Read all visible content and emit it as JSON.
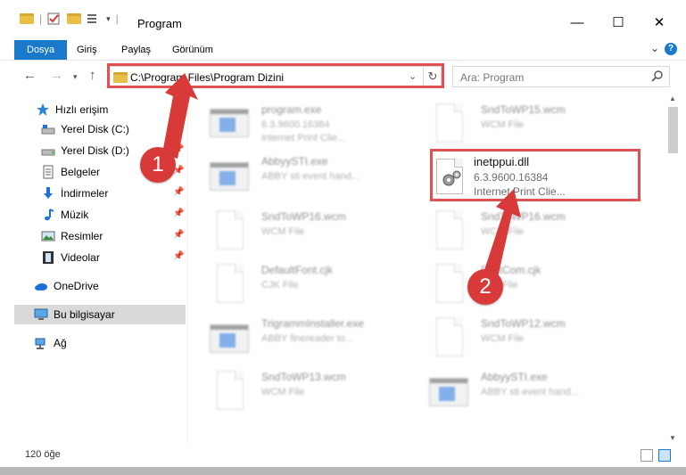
{
  "window": {
    "title": "Program"
  },
  "ribbon": {
    "tabs": [
      "Dosya",
      "Giriş",
      "Paylaş",
      "Görünüm"
    ]
  },
  "address": {
    "path": "C:\\Program Files\\Program Dizini"
  },
  "search": {
    "placeholder": "Ara: Program"
  },
  "sidebar": {
    "quick_access": "Hızlı erişim",
    "items": [
      {
        "label": "Yerel Disk (C:)",
        "icon": "drive-icon"
      },
      {
        "label": "Yerel Disk (D:)",
        "icon": "drive-icon"
      },
      {
        "label": "Belgeler",
        "icon": "documents-icon"
      },
      {
        "label": "İndirmeler",
        "icon": "downloads-icon"
      },
      {
        "label": "Müzik",
        "icon": "music-icon"
      },
      {
        "label": "Resimler",
        "icon": "pictures-icon"
      },
      {
        "label": "Videolar",
        "icon": "videos-icon"
      }
    ],
    "onedrive": "OneDrive",
    "this_pc": "Bu bilgisayar",
    "network": "Ağ"
  },
  "files": [
    {
      "name": "program.exe",
      "line1": "6.3.9600.16384",
      "line2": "Internet Print Clie...",
      "icon": "exe-icon"
    },
    {
      "name": "SndToWP15.wcm",
      "line1": "WCM File",
      "line2": "",
      "icon": "document-icon"
    },
    {
      "name": "AbbyySTI.exe",
      "line1": "ABBY sti event hand...",
      "line2": "",
      "icon": "app-window-icon"
    },
    {
      "name": "inetppui.dll",
      "line1": "6.3.9600.16384",
      "line2": "Internet Print Clie...",
      "icon": "dll-gear-icon"
    },
    {
      "name": "SndToWP16.wcm",
      "line1": "WCM File",
      "line2": "",
      "icon": "document-icon"
    },
    {
      "name": "SndToWP16.wcm",
      "line1": "WCM File",
      "line2": "",
      "icon": "document-icon"
    },
    {
      "name": "DefaultFont.cjk",
      "line1": "CJK File",
      "line2": "",
      "icon": "document-icon"
    },
    {
      "name": "FontCom.cjk",
      "line1": "CJK File",
      "line2": "",
      "icon": "document-icon"
    },
    {
      "name": "TrigrammInstaller.exe",
      "line1": "ABBY finereader to...",
      "line2": "",
      "icon": "app-window-icon"
    },
    {
      "name": "SndToWP12.wcm",
      "line1": "WCM File",
      "line2": "",
      "icon": "document-icon"
    },
    {
      "name": "SndToWP13.wcm",
      "line1": "WCM File",
      "line2": "",
      "icon": "document-icon"
    },
    {
      "name": "AbbyySTI.exe",
      "line1": "ABBY sti event hand...",
      "line2": "",
      "icon": "app-window-icon"
    }
  ],
  "status": {
    "count": "120 öğe"
  },
  "callouts": [
    "1",
    "2"
  ],
  "colors": {
    "accent": "#1979ca",
    "highlight": "#e05252",
    "callout": "#d83a3a"
  }
}
